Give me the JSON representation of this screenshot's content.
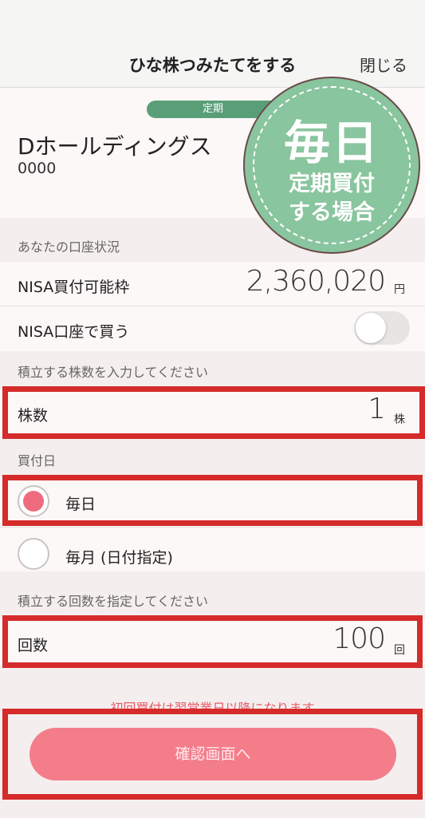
{
  "header": {
    "title": "ひな株つみたてをする",
    "close_label": "閉じる"
  },
  "stock": {
    "badge": "定期",
    "name": "Dホールディングス",
    "code": "0000"
  },
  "stamp": {
    "big": "毎日",
    "line1": "定期買付",
    "line2": "する場合",
    "color": "#89c59e"
  },
  "account": {
    "section_label": "あなたの口座状況",
    "nisa_limit_label": "NISA買付可能枠",
    "nisa_limit_value": "2,360,020",
    "nisa_limit_unit": "円",
    "nisa_buy_label": "NISA口座で買う",
    "nisa_toggle_on": false
  },
  "shares": {
    "section_label": "積立する株数を入力してください",
    "label": "株数",
    "value": "1",
    "unit": "株"
  },
  "buy_day": {
    "section_label": "買付日",
    "options": [
      {
        "label": "毎日",
        "selected": true
      },
      {
        "label": "毎月 (日付指定)",
        "selected": false
      }
    ]
  },
  "count": {
    "section_label": "積立する回数を指定してください",
    "label": "回数",
    "value": "100",
    "unit": "回"
  },
  "footer": {
    "notice": "初回買付は翌営業日以降になります",
    "confirm_label": "確認画面へ"
  },
  "colors": {
    "accent": "#f47d8a",
    "highlight": "#d52b2b",
    "badge": "#5a9e78"
  }
}
